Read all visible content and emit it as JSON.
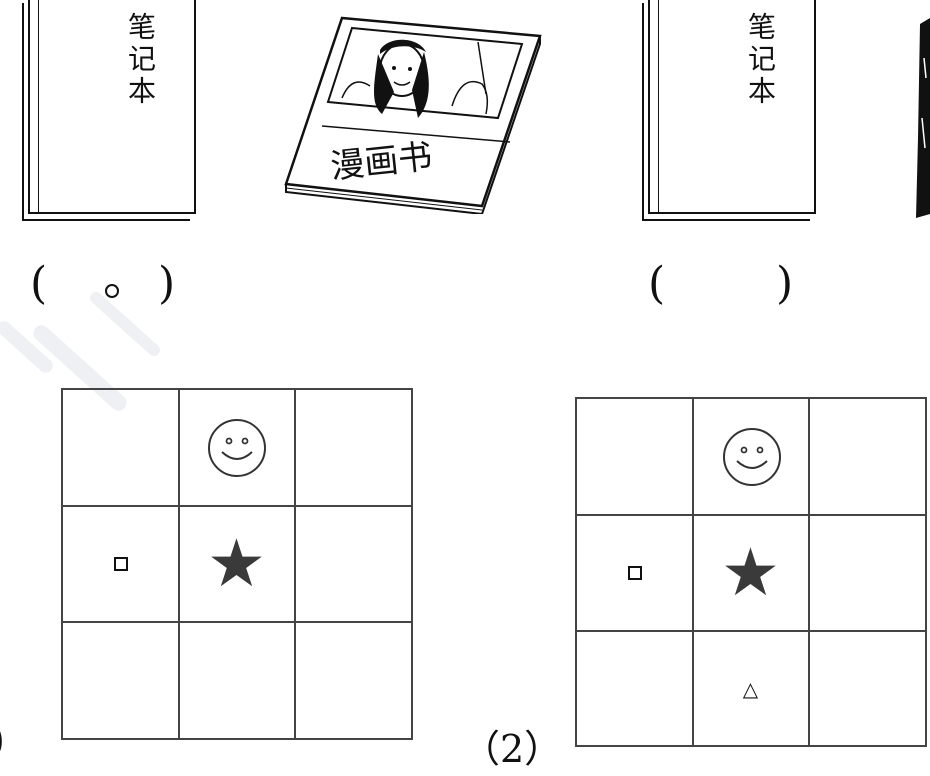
{
  "watermark": {
    "color": "#eef0f4"
  },
  "item1": {
    "notebook_text": "笔记本",
    "comic_text": "漫画书",
    "paren_open": "(",
    "paren_close": ")",
    "answer_mark": "circle"
  },
  "item2": {
    "notebook_text": "笔记本",
    "paren_open": "(",
    "paren_close": ")"
  },
  "grid1": {
    "number_label": ")",
    "cells": [
      [
        "",
        "smiley",
        ""
      ],
      [
        "square",
        "star",
        ""
      ],
      [
        "",
        "",
        ""
      ]
    ]
  },
  "grid2": {
    "number_label": "（2）",
    "cells": [
      [
        "",
        "smiley",
        ""
      ],
      [
        "square",
        "star",
        ""
      ],
      [
        "",
        "triangle",
        ""
      ]
    ]
  },
  "symbols": {
    "star": "★",
    "triangle": "△"
  }
}
